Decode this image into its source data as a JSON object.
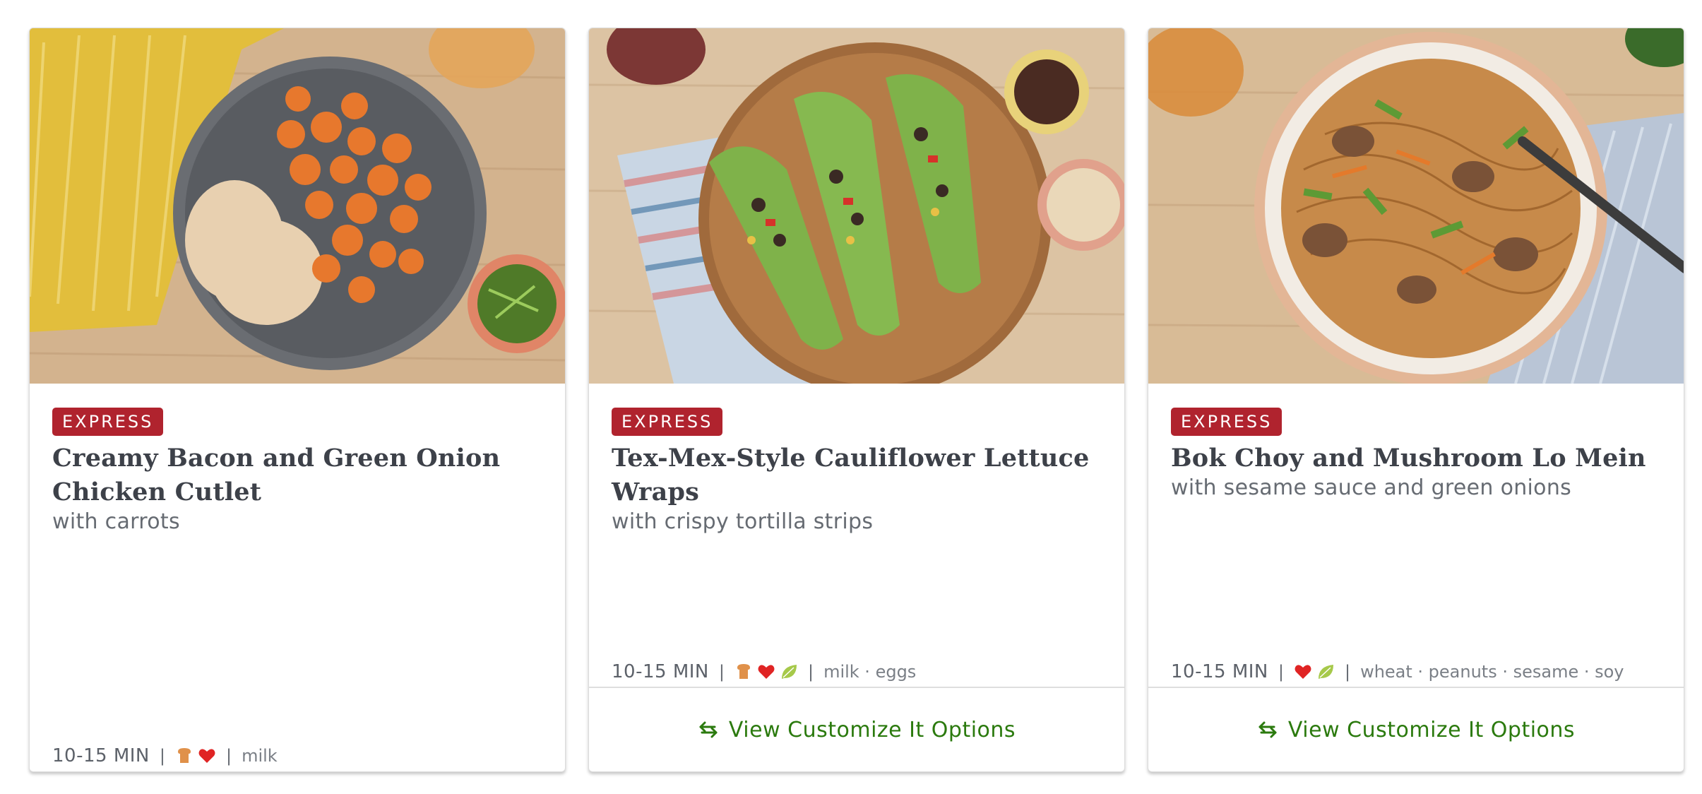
{
  "cards": [
    {
      "badge": "EXPRESS",
      "title": "Creamy Bacon and Green Onion Chicken Cutlet",
      "subtitle": "with carrots",
      "time": "10-15 MIN",
      "sep": "|",
      "icons": [
        "carb-icon",
        "heart-icon"
      ],
      "allergens": "milk",
      "action": null
    },
    {
      "badge": "EXPRESS",
      "title": "Tex-Mex-Style Cauliflower Lettuce Wraps",
      "subtitle": "with crispy tortilla strips",
      "time": "10-15 MIN",
      "sep": "|",
      "icons": [
        "carb-icon",
        "heart-icon",
        "leaf-icon"
      ],
      "allergens": "milk · eggs",
      "action": "View Customize It Options"
    },
    {
      "badge": "EXPRESS",
      "title": "Bok Choy and Mushroom Lo Mein",
      "subtitle": "with sesame sauce and green onions",
      "time": "10-15 MIN",
      "sep": "|",
      "icons": [
        "heart-icon",
        "leaf-icon"
      ],
      "allergens": "wheat · peanuts · sesame · soy",
      "action": "View Customize It Options"
    }
  ],
  "colors": {
    "badge": "#b0232e",
    "action": "#2b7a0e",
    "title": "#3d4149",
    "carb": "#e0914a",
    "heart": "#e02424",
    "leaf": "#a6c94a"
  }
}
